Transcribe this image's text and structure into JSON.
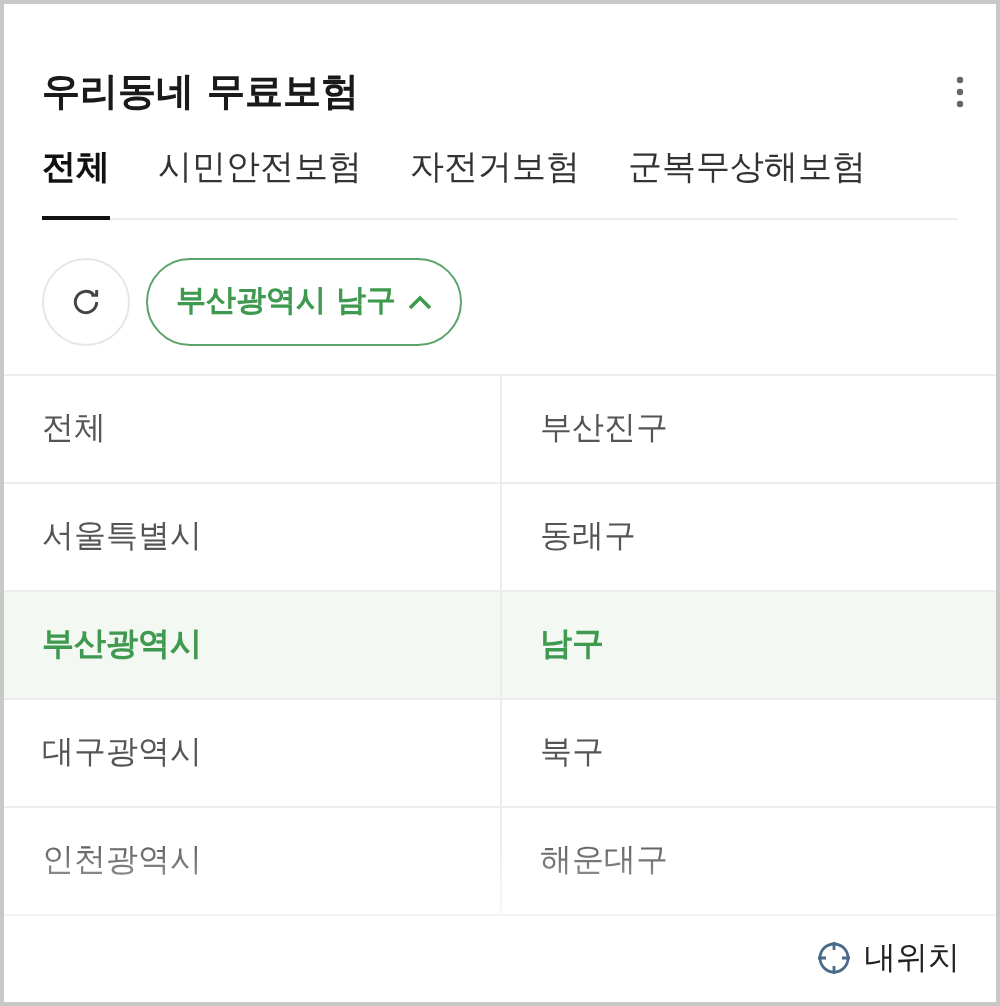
{
  "title": "우리동네 무료보험",
  "tabs": [
    {
      "label": "전체",
      "selected": true
    },
    {
      "label": "시민안전보험",
      "selected": false
    },
    {
      "label": "자전거보험",
      "selected": false
    },
    {
      "label": "군복무상해보험",
      "selected": false
    }
  ],
  "region_filter": {
    "label": "부산광역시 남구",
    "expanded": true
  },
  "region_table": {
    "rows": [
      [
        {
          "label": "전체",
          "selected": false
        },
        {
          "label": "부산진구",
          "selected": false
        }
      ],
      [
        {
          "label": "서울특별시",
          "selected": false
        },
        {
          "label": "동래구",
          "selected": false
        }
      ],
      [
        {
          "label": "부산광역시",
          "selected": true
        },
        {
          "label": "남구",
          "selected": true
        }
      ],
      [
        {
          "label": "대구광역시",
          "selected": false
        },
        {
          "label": "북구",
          "selected": false
        }
      ],
      [
        {
          "label": "인천광역시",
          "selected": false
        },
        {
          "label": "해운대구",
          "selected": false
        }
      ]
    ]
  },
  "footer": {
    "my_location": "내위치"
  }
}
